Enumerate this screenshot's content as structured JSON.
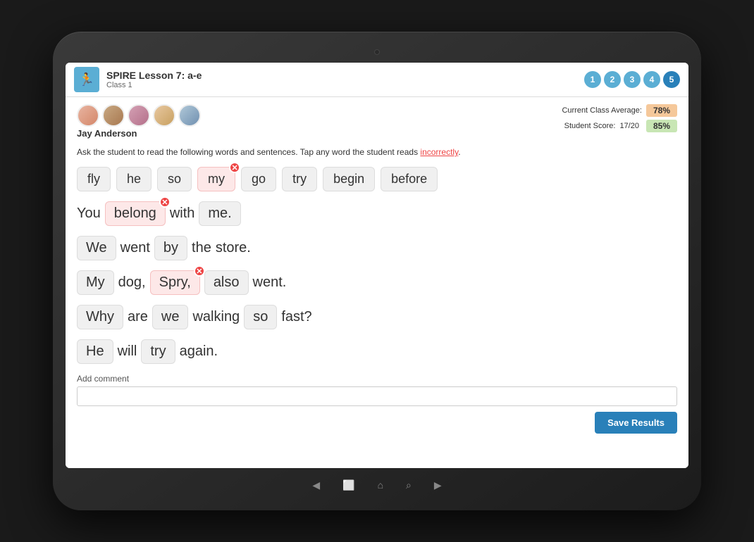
{
  "tablet": {
    "bg": "#2a2a2a"
  },
  "header": {
    "title": "SPIRE Lesson 7: a-e",
    "subtitle": "Class 1",
    "icon_symbol": "🏃",
    "steps": [
      "1",
      "2",
      "3",
      "4",
      "5"
    ]
  },
  "student": {
    "name": "Jay Anderson",
    "class_avg_label": "Current Class Average:",
    "class_avg_value": "78%",
    "student_score_label": "Student Score:",
    "student_score_raw": "17/20",
    "student_score_pct": "85%"
  },
  "instructions": "Ask the student to read the following words and sentences.  Tap any word the student reads ",
  "instructions_underline": "incorrectly",
  "instructions_end": ".",
  "words": [
    {
      "text": "fly",
      "error": false
    },
    {
      "text": "he",
      "error": false
    },
    {
      "text": "so",
      "error": false
    },
    {
      "text": "my",
      "error": true
    },
    {
      "text": "go",
      "error": false
    },
    {
      "text": "try",
      "error": false
    },
    {
      "text": "begin",
      "error": false
    },
    {
      "text": "before",
      "error": false
    }
  ],
  "sentences": [
    {
      "words": [
        {
          "text": "You",
          "type": "plain"
        },
        {
          "text": "belong",
          "type": "error"
        },
        {
          "text": "with",
          "type": "plain"
        },
        {
          "text": "me.",
          "type": "chip"
        }
      ]
    },
    {
      "words": [
        {
          "text": "We",
          "type": "chip"
        },
        {
          "text": "went",
          "type": "plain"
        },
        {
          "text": "by",
          "type": "chip"
        },
        {
          "text": "the",
          "type": "plain"
        },
        {
          "text": "store.",
          "type": "plain"
        }
      ]
    },
    {
      "words": [
        {
          "text": "My",
          "type": "chip"
        },
        {
          "text": "dog,",
          "type": "plain"
        },
        {
          "text": "Spry,",
          "type": "error"
        },
        {
          "text": "also",
          "type": "chip"
        },
        {
          "text": "went.",
          "type": "plain"
        }
      ]
    },
    {
      "words": [
        {
          "text": "Why",
          "type": "chip"
        },
        {
          "text": "are",
          "type": "plain"
        },
        {
          "text": "we",
          "type": "chip"
        },
        {
          "text": "walking",
          "type": "plain"
        },
        {
          "text": "so",
          "type": "chip"
        },
        {
          "text": "fast?",
          "type": "plain"
        }
      ]
    },
    {
      "words": [
        {
          "text": "He",
          "type": "chip"
        },
        {
          "text": "will",
          "type": "plain"
        },
        {
          "text": "try",
          "type": "chip"
        },
        {
          "text": "again.",
          "type": "plain"
        }
      ]
    }
  ],
  "comment": {
    "label": "Add comment",
    "placeholder": ""
  },
  "save_button": "Save Results",
  "nav": {
    "back": "◀",
    "square": "⬜",
    "home": "⌂",
    "search": "⌕",
    "forward": "▶"
  }
}
